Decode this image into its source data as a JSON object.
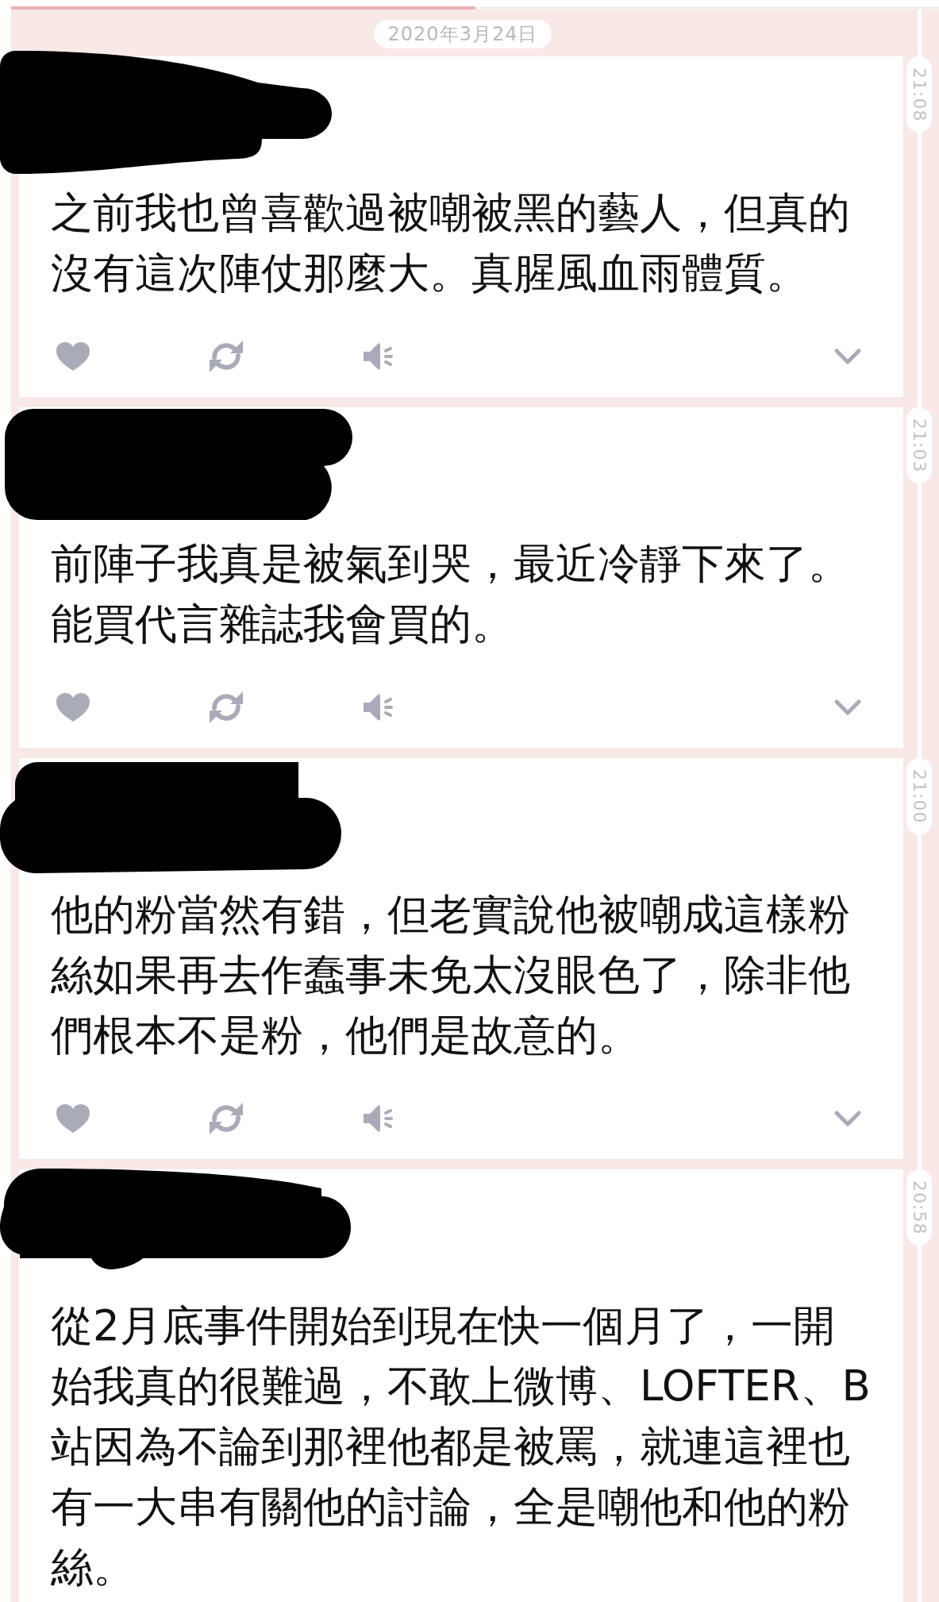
{
  "loading_bar": {
    "level": 0.5
  },
  "date": "2020年3月24日",
  "posts": [
    {
      "author_redacted": true,
      "time": "21:08",
      "text": "之前我也曾喜歡過被嘲被黑的藝人，但真的沒有這次陣仗那麼大。真腥風血雨體質。",
      "toolbar_visible": true
    },
    {
      "author_redacted": true,
      "time": "21:03",
      "text": "前陣子我真是被氣到哭，最近冷靜下來了。能買代言雜誌我會買的。",
      "toolbar_visible": true
    },
    {
      "author_redacted": true,
      "time": "21:00",
      "text": "他的粉當然有錯，但老實說他被嘲成這樣粉絲如果再去作蠢事未免太沒眼色了，除非他們根本不是粉，他們是故意的。",
      "toolbar_visible": true
    },
    {
      "author_redacted": true,
      "time": "20:58",
      "text": "從2月底事件開始到現在快一個月了，一開始我真的很難過，不敢上微博、LOFTER、B站因為不論到那裡他都是被罵，就連這裡也有一大串有關他的討論，全是嘲他和他的粉絲。",
      "toolbar_visible": false
    }
  ]
}
